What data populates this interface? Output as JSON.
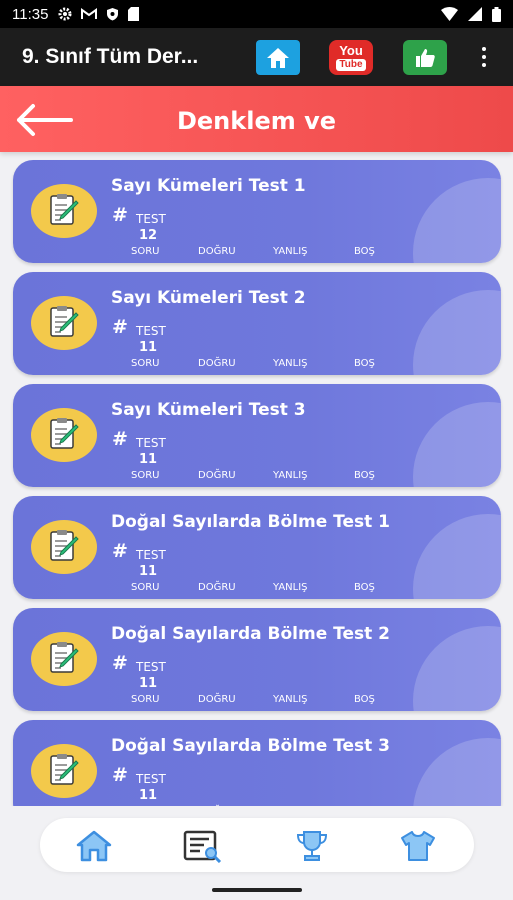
{
  "status_bar": {
    "time": "11:35"
  },
  "app_bar": {
    "title": "9. Sınıf Tüm Der...",
    "youtube_top": "You",
    "youtube_bottom": "Tube"
  },
  "header": {
    "title": "Denklem ve"
  },
  "cards": [
    {
      "title": "Sayı Kümeleri Test 1",
      "test_label": "TEST",
      "count": "12"
    },
    {
      "title": "Sayı Kümeleri Test 2",
      "test_label": "TEST",
      "count": "11"
    },
    {
      "title": "Sayı Kümeleri Test 3",
      "test_label": "TEST",
      "count": "11"
    },
    {
      "title": "Doğal Sayılarda Bölme Test 1",
      "test_label": "TEST",
      "count": "11"
    },
    {
      "title": "Doğal Sayılarda Bölme Test 2",
      "test_label": "TEST",
      "count": "11"
    },
    {
      "title": "Doğal Sayılarda Bölme Test 3",
      "test_label": "TEST",
      "count": "11"
    }
  ],
  "columns": {
    "soru": "SORU",
    "dogru": "DOĞRU",
    "yanlis": "YANLIŞ",
    "bos": "BOŞ"
  },
  "icons": {
    "home_button": "home-icon",
    "youtube_button": "youtube-icon",
    "like_button": "thumbs-up-icon",
    "more": "more-vert-icon",
    "back": "arrow-left-icon",
    "nav": [
      "home-icon",
      "list-search-icon",
      "trophy-icon",
      "shirt-icon"
    ]
  },
  "colors": {
    "header": "#ff6161",
    "card": "#6f78dc",
    "badge": "#f3c94b",
    "home_btn": "#1da1e0",
    "youtube_btn": "#e02b28",
    "like_btn": "#2ea24a",
    "nav_icon": "#5aa9ef"
  }
}
